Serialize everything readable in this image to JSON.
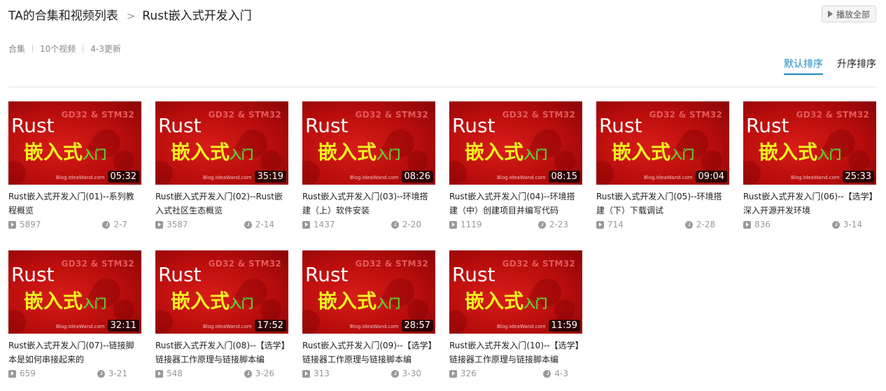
{
  "header": {
    "collection_owner": "TA的合集和视频列表",
    "separator": ">",
    "collection_title": "Rust嵌入式开发入门",
    "play_all_label": "播放全部"
  },
  "meta": {
    "type": "合集",
    "count": "10个视频",
    "updated": "4-3更新"
  },
  "sort": {
    "default_label": "默认排序",
    "asc_label": "升序排序"
  },
  "thumbnail": {
    "subtitle": "GD32 & STM32",
    "rust": "Rust",
    "cn_big": "嵌入式",
    "cn_small": "入门",
    "blog": "Blog.IdeaWand.com"
  },
  "videos": [
    {
      "title": "Rust嵌入式开发入门(01)--系列教程概览",
      "duration": "05:32",
      "views": "5897",
      "date": "2-7"
    },
    {
      "title": "Rust嵌入式开发入门(02)--Rust嵌入式社区生态概览",
      "duration": "35:19",
      "views": "3587",
      "date": "2-14"
    },
    {
      "title": "Rust嵌入式开发入门(03)--环境搭建（上）软件安装",
      "duration": "08:26",
      "views": "1437",
      "date": "2-20"
    },
    {
      "title": "Rust嵌入式开发入门(04)--环境搭建（中）创建项目并编写代码",
      "duration": "08:15",
      "views": "1119",
      "date": "2-23"
    },
    {
      "title": "Rust嵌入式开发入门(05)--环境搭建（下）下载调试",
      "duration": "09:04",
      "views": "714",
      "date": "2-28"
    },
    {
      "title": "Rust嵌入式开发入门(06)--【选学】深入开源开发环境",
      "duration": "25:33",
      "views": "836",
      "date": "3-14"
    },
    {
      "title": "Rust嵌入式开发入门(07)--链接脚本是如何串接起来的",
      "duration": "32:11",
      "views": "659",
      "date": "3-21"
    },
    {
      "title": "Rust嵌入式开发入门(08)--【选学】链接器工作原理与链接脚本编",
      "duration": "17:52",
      "views": "548",
      "date": "3-26"
    },
    {
      "title": "Rust嵌入式开发入门(09)--【选学】链接器工作原理与链接脚本编",
      "duration": "28:57",
      "views": "313",
      "date": "3-30"
    },
    {
      "title": "Rust嵌入式开发入门(10)--【选学】链接器工作原理与链接脚本编",
      "duration": "11:59",
      "views": "326",
      "date": "4-3"
    }
  ]
}
